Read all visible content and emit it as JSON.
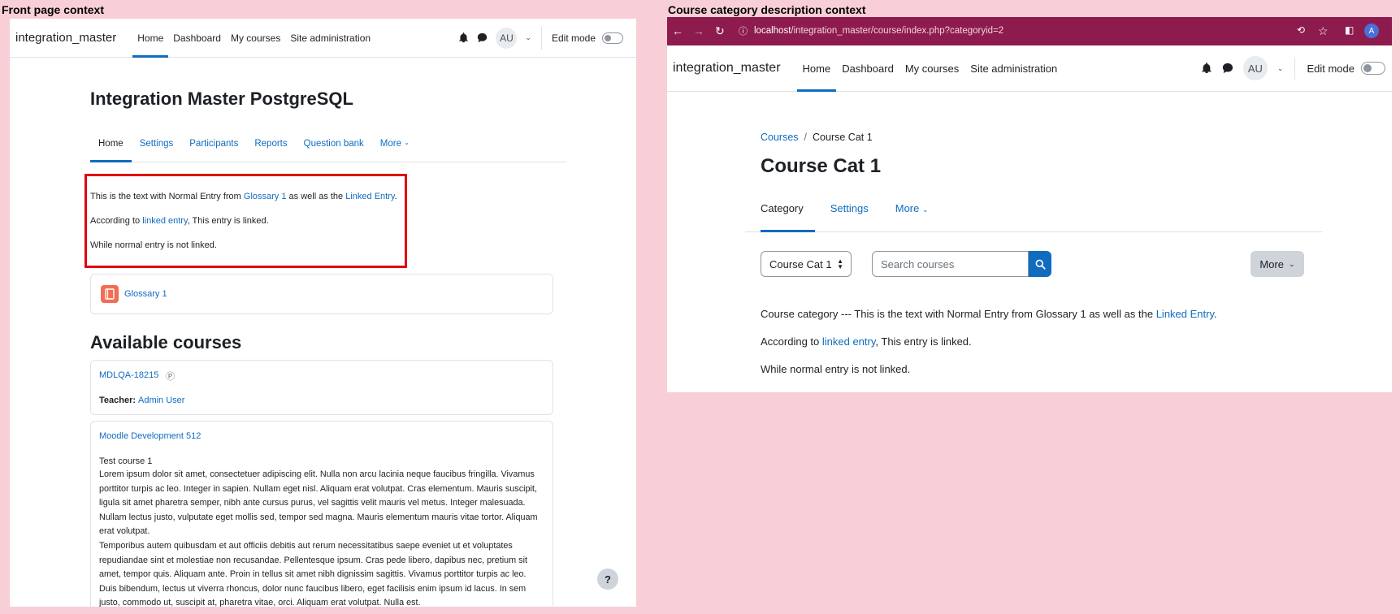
{
  "labels": {
    "left": "Front page context",
    "right": "Course category description context"
  },
  "left": {
    "brand": "integration_master",
    "nav": [
      "Home",
      "Dashboard",
      "My courses",
      "Site administration"
    ],
    "avatar": "AU",
    "edit_mode": "Edit mode",
    "page_title": "Integration Master PostgreSQL",
    "secnav": [
      "Home",
      "Settings",
      "Participants",
      "Reports",
      "Question bank",
      "More"
    ],
    "content": {
      "p1_before": "This is the text with Normal Entry from ",
      "p1_link1": "Glossary 1",
      "p1_middle": " as well as the ",
      "p1_link2": "Linked Entry",
      "p1_after": ".",
      "p2_before": "According to ",
      "p2_link": "linked entry",
      "p2_after": ", This entry is linked.",
      "p3": "While normal entry is not linked."
    },
    "glossary_activity": "Glossary 1",
    "available_courses": "Available courses",
    "courses": [
      {
        "name": "MDLQA-18215",
        "teacher_label": "Teacher:",
        "teacher": "Admin User"
      },
      {
        "name": "Moodle Development 512",
        "summary_title": "Test course 1",
        "summary_p1": "Lorem ipsum dolor sit amet, consectetuer adipiscing elit. Nulla non arcu lacinia neque faucibus fringilla. Vivamus porttitor turpis ac leo. Integer in sapien. Nullam eget nisl. Aliquam erat volutpat. Cras elementum. Mauris suscipit, ligula sit amet pharetra semper, nibh ante cursus purus, vel sagittis velit mauris vel metus. Integer malesuada. Nullam lectus justo, vulputate eget mollis sed, tempor sed magna. Mauris elementum mauris vitae tortor. Aliquam erat volutpat.",
        "summary_p2": "Temporibus autem quibusdam et aut officiis debitis aut rerum necessitatibus saepe eveniet ut et voluptates repudiandae sint et molestiae non recusandae. Pellentesque ipsum. Cras pede libero, dapibus nec, pretium sit amet, tempor quis. Aliquam ante. Proin in tellus sit amet nibh dignissim sagittis. Vivamus porttitor turpis ac leo. Duis bibendum, lectus ut viverra rhoncus, dolor nunc faucibus libero, eget facilisis enim ipsum id lacus. In sem justo, commodo ut, suscipit at, pharetra vitae, orci. Aliquam erat volutpat. Nulla est."
      }
    ],
    "help": "?"
  },
  "right": {
    "url_host": "localhost",
    "url_path": "/integration_master/course/index.php?categoryid=2",
    "profile_initial": "A",
    "brand": "integration_master",
    "nav": [
      "Home",
      "Dashboard",
      "My courses",
      "Site administration"
    ],
    "avatar": "AU",
    "edit_mode": "Edit mode",
    "breadcrumb": [
      "Courses",
      "Course Cat 1"
    ],
    "title": "Course Cat 1",
    "secnav": [
      "Category",
      "Settings",
      "More"
    ],
    "category_select": "Course Cat 1",
    "search_placeholder": "Search courses",
    "more_button": "More",
    "content": {
      "p1_before": "Course category --- This is the text with Normal Entry from Glossary 1 as well as the ",
      "p1_link": "Linked Entry",
      "p1_after": ".",
      "p2_before": "According to ",
      "p2_link": "linked entry",
      "p2_after": ", This entry is linked.",
      "p3": "While normal entry is not linked."
    }
  },
  "colors": {
    "accent": "#0f6cbf",
    "chrome": "#8e1b4e",
    "highlight_border": "#e1000f",
    "background": "#f8cfd6"
  }
}
